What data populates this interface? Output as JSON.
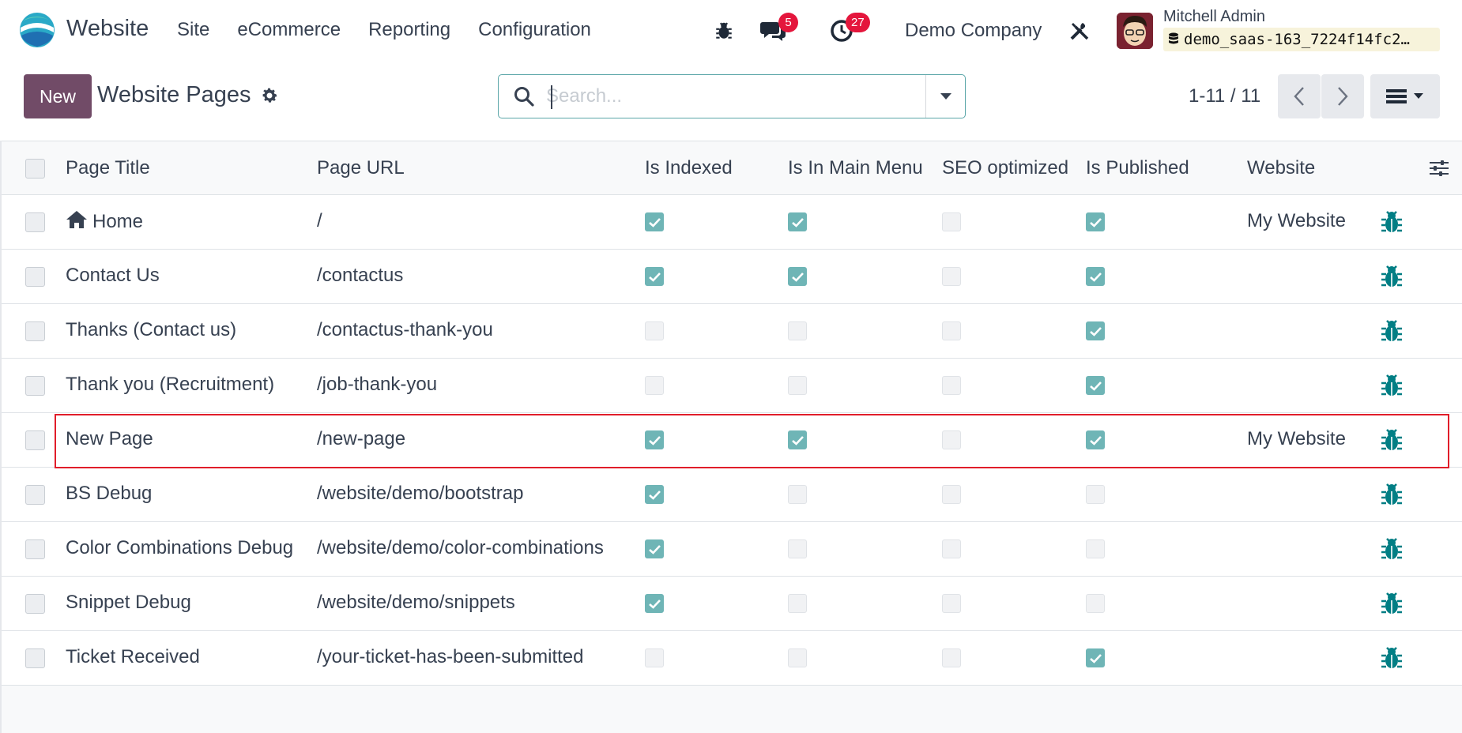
{
  "navbar": {
    "app_name": "Website",
    "menu": [
      "Site",
      "eCommerce",
      "Reporting",
      "Configuration"
    ],
    "messages_count": "5",
    "activities_count": "27",
    "company": "Demo Company",
    "user_name": "Mitchell Admin",
    "database": "demo_saas-163_7224f14fc2…"
  },
  "control_panel": {
    "new_label": "New",
    "title": "Website Pages",
    "search_placeholder": "Search...",
    "pager": "1-11 / 11"
  },
  "table": {
    "columns": [
      "Page Title",
      "Page URL",
      "Is Indexed",
      "Is In Main Menu",
      "SEO optimized",
      "Is Published",
      "Website"
    ],
    "rows": [
      {
        "title": "Home",
        "url": "/",
        "indexed": true,
        "main_menu": true,
        "seo": false,
        "published": true,
        "website": "My Website",
        "home": true
      },
      {
        "title": "Contact Us",
        "url": "/contactus",
        "indexed": true,
        "main_menu": true,
        "seo": false,
        "published": true,
        "website": ""
      },
      {
        "title": "Thanks (Contact us)",
        "url": "/contactus-thank-you",
        "indexed": false,
        "main_menu": false,
        "seo": false,
        "published": true,
        "website": ""
      },
      {
        "title": "Thank you (Recruitment)",
        "url": "/job-thank-you",
        "indexed": false,
        "main_menu": false,
        "seo": false,
        "published": true,
        "website": ""
      },
      {
        "title": "New Page",
        "url": "/new-page",
        "indexed": true,
        "main_menu": true,
        "seo": false,
        "published": true,
        "website": "My Website",
        "highlighted": true
      },
      {
        "title": "BS Debug",
        "url": "/website/demo/bootstrap",
        "indexed": true,
        "main_menu": false,
        "seo": false,
        "published": false,
        "website": ""
      },
      {
        "title": "Color Combinations Debug",
        "url": "/website/demo/color-combinations",
        "indexed": true,
        "main_menu": false,
        "seo": false,
        "published": false,
        "website": ""
      },
      {
        "title": "Snippet Debug",
        "url": "/website/demo/snippets",
        "indexed": true,
        "main_menu": false,
        "seo": false,
        "published": false,
        "website": ""
      },
      {
        "title": "Ticket Received",
        "url": "/your-ticket-has-been-submitted",
        "indexed": false,
        "main_menu": false,
        "seo": false,
        "published": true,
        "website": ""
      }
    ]
  },
  "colors": {
    "brand": "#714b67",
    "accent": "#017e84",
    "checked": "#6fb5b6",
    "badge": "#e4163c",
    "highlight_border": "#e11d2a"
  },
  "icons": [
    "website-logo-icon",
    "bug-icon",
    "chat-icon",
    "clock-icon",
    "tools-icon",
    "database-icon",
    "gear-icon",
    "search-icon",
    "caret-down-icon",
    "chevron-left-icon",
    "chevron-right-icon",
    "list-view-icon",
    "home-icon",
    "column-settings-icon"
  ]
}
